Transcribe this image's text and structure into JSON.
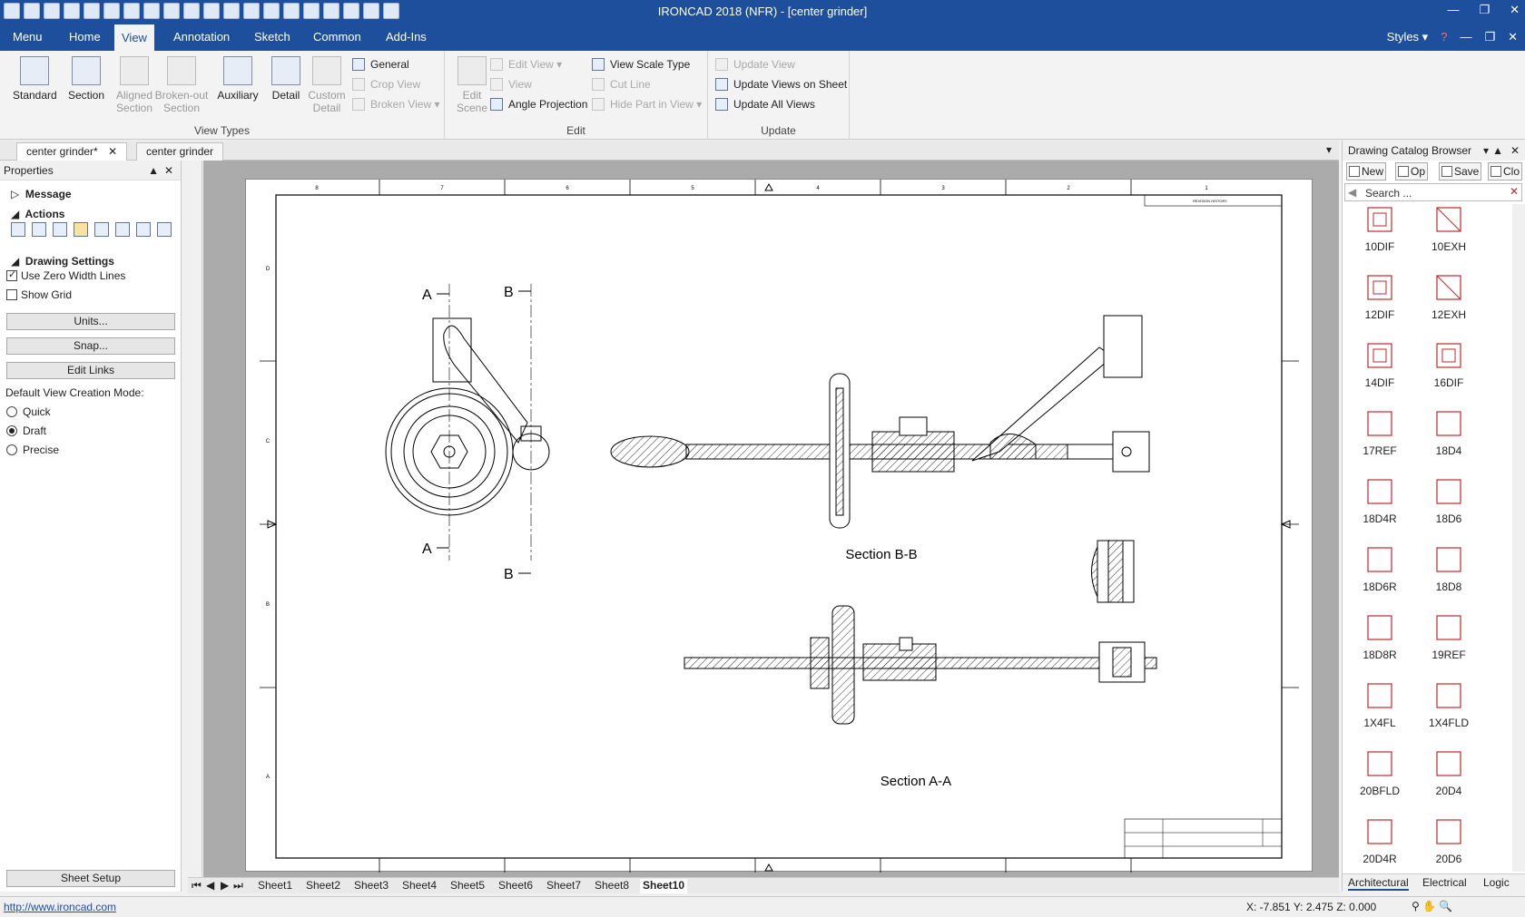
{
  "title": "IRONCAD 2018 (NFR) - [center grinder]",
  "menu_tabs": [
    "Menu",
    "Home",
    "View",
    "Annotation",
    "Sketch",
    "Common",
    "Add-Ins"
  ],
  "active_tab": "View",
  "styles_label": "Styles",
  "ribbon": {
    "view_types": {
      "label": "View Types",
      "big": [
        "Standard",
        "Section",
        "Aligned Section",
        "Broken-out Section",
        "Auxiliary",
        "Detail",
        "Custom Detail"
      ],
      "small": [
        "General",
        "Crop View",
        "Broken View"
      ]
    },
    "edit": {
      "label": "Edit",
      "big": [
        "Edit Scene"
      ],
      "small": [
        "Edit View",
        "View",
        "Angle Projection",
        "View Scale Type",
        "Cut Line",
        "Hide Part in View"
      ]
    },
    "update": {
      "label": "Update",
      "small": [
        "Update View",
        "Update Views on Sheet",
        "Update All Views"
      ]
    }
  },
  "doc_tabs": [
    "center grinder*",
    "center grinder"
  ],
  "properties": {
    "title": "Properties",
    "message": "Message",
    "actions": "Actions",
    "drawing_settings": "Drawing Settings",
    "use_zero_width": "Use Zero Width Lines",
    "show_grid": "Show Grid",
    "units_btn": "Units...",
    "snap_btn": "Snap...",
    "edit_links_btn": "Edit Links",
    "default_mode_label": "Default View Creation Mode:",
    "modes": [
      "Quick",
      "Draft",
      "Precise"
    ],
    "selected_mode": "Draft",
    "sheet_setup_btn": "Sheet Setup"
  },
  "drawing": {
    "section_bb": "Section B-B",
    "section_aa": "Section A-A",
    "label_a": "A",
    "label_b": "B",
    "border_top": [
      "8",
      "7",
      "6",
      "5",
      "4",
      "3",
      "2",
      "1"
    ],
    "border_side": [
      "D",
      "C",
      "B",
      "A"
    ],
    "revision": "REVISION HISTORY"
  },
  "sheet_tabs": [
    "Sheet1",
    "Sheet2",
    "Sheet3",
    "Sheet4",
    "Sheet5",
    "Sheet6",
    "Sheet7",
    "Sheet8",
    "Sheet10"
  ],
  "active_sheet": "Sheet10",
  "catalog": {
    "title": "Drawing Catalog Browser",
    "tools": [
      "New",
      "Op",
      "Save",
      "Clo"
    ],
    "search_placeholder": "Search ...",
    "items": [
      "10DIF",
      "10EXH",
      "12DIF",
      "12EXH",
      "14DIF",
      "16DIF",
      "17REF",
      "18D4",
      "18D4R",
      "18D6",
      "18D6R",
      "18D8",
      "18D8R",
      "19REF",
      "1X4FL",
      "1X4FLD",
      "20BFLD",
      "20D4",
      "20D4R",
      "20D6"
    ],
    "bottom_tabs": [
      "Architectural",
      "Electrical",
      "Logic"
    ]
  },
  "status": {
    "link": "http://www.ironcad.com",
    "coords": "X: -7.851 Y: 2.475 Z: 0.000"
  },
  "colors": {
    "accent": "#1e4f9c",
    "icon_red": "#c0282d"
  }
}
